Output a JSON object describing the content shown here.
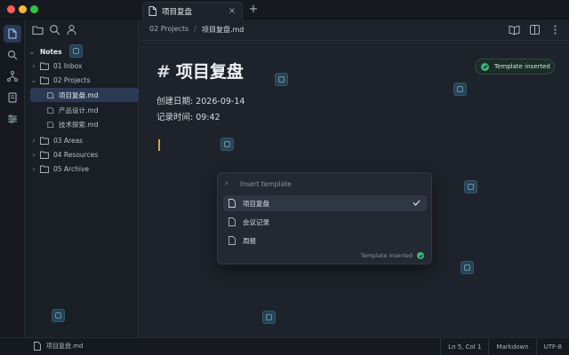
{
  "tab": {
    "label": "项目复盘",
    "close": "×",
    "new_tab": "+"
  },
  "sidebar": {
    "tree": [
      {
        "label": "Notes",
        "type": "root"
      },
      {
        "label": "01 Inbox",
        "type": "folder",
        "expanded": false
      },
      {
        "label": "02 Projects",
        "type": "folder",
        "expanded": true
      },
      {
        "label": "项目复盘.md",
        "type": "file",
        "selected": true
      },
      {
        "label": "产品设计.md",
        "type": "file"
      },
      {
        "label": "技术探索.md",
        "type": "file"
      },
      {
        "label": "03 Areas",
        "type": "folder",
        "expanded": false
      },
      {
        "label": "04 Resources",
        "type": "folder",
        "expanded": false
      },
      {
        "label": "05 Archive",
        "type": "folder",
        "expanded": false
      }
    ]
  },
  "breadcrumb": {
    "folder": "02 Projects",
    "sep": "/",
    "file": "项目复盘.md"
  },
  "editor": {
    "heading_hash": "#",
    "heading": "项目复盘",
    "meta_line1": "创建日期: 2026-09-14",
    "meta_line2": "记录时间: 09:42"
  },
  "toast": {
    "label": "Template inserted",
    "color": "#3fb27f"
  },
  "popup": {
    "placeholder": "Insert template",
    "items": [
      {
        "label": "项目复盘",
        "selected": true
      },
      {
        "label": "会议记录"
      },
      {
        "label": "周报"
      }
    ],
    "footer": "Template inserted"
  },
  "status": {
    "file": "项目复盘.md",
    "position": "Ln 5, Col 1",
    "mode": "Markdown",
    "encoding": "UTF-8"
  },
  "colors": {
    "accent": "#2b3a52",
    "success": "#3fb27f",
    "cursor": "#d8a33a"
  }
}
